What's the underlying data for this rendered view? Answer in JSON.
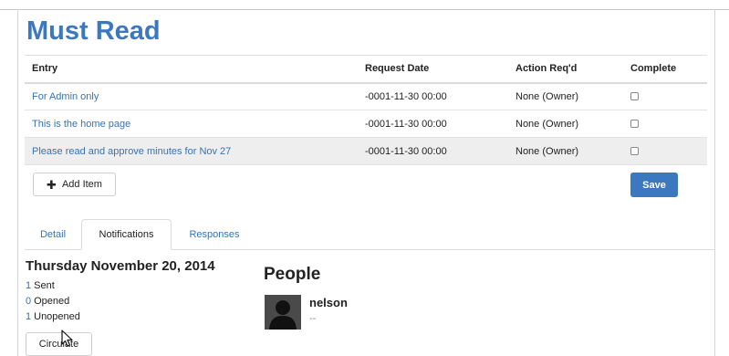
{
  "page": {
    "title": "Must Read"
  },
  "table": {
    "headers": [
      "Entry",
      "Request Date",
      "Action Req'd",
      "Complete"
    ],
    "rows": [
      {
        "entry": "For Admin only",
        "request_date": "-0001-11-30 00:00",
        "action": "None (Owner)",
        "complete": false
      },
      {
        "entry": "This is the home page",
        "request_date": "-0001-11-30 00:00",
        "action": "None (Owner)",
        "complete": false
      },
      {
        "entry": "Please read and approve minutes for Nov 27",
        "request_date": "-0001-11-30 00:00",
        "action": "None (Owner)",
        "complete": false
      }
    ]
  },
  "buttons": {
    "add_item": "Add Item",
    "save": "Save",
    "circulate": "Circulate"
  },
  "tabs": [
    {
      "label": "Detail",
      "active": false
    },
    {
      "label": "Notifications",
      "active": true
    },
    {
      "label": "Responses",
      "active": false
    }
  ],
  "notifications": {
    "date": "Thursday November 20, 2014",
    "sent_count": "1",
    "sent_label": "Sent",
    "opened_count": "0",
    "opened_label": "Opened",
    "unopened_count": "1",
    "unopened_label": "Unopened"
  },
  "people": {
    "title": "People",
    "person": {
      "name": "nelson",
      "detail": "--"
    }
  },
  "icons": {
    "add": "plus-icon",
    "avatar": "user-silhouette-icon",
    "cursor": "mouse-cursor-icon"
  },
  "colors": {
    "accent": "#3b78c0",
    "link": "#3573b5"
  }
}
